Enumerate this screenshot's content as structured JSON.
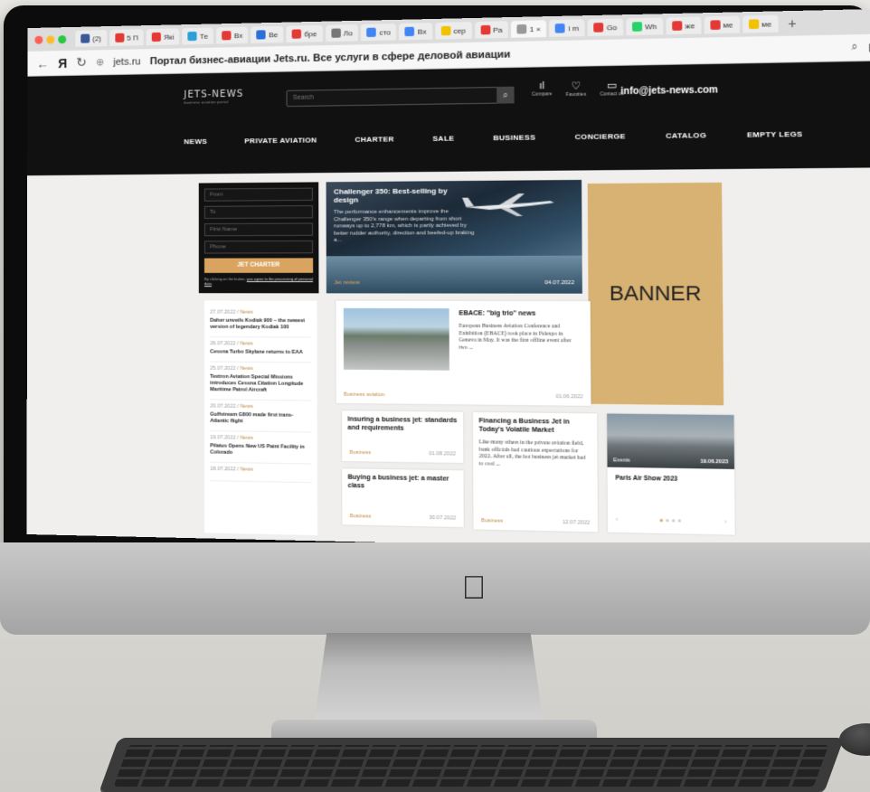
{
  "browser": {
    "tabs": [
      {
        "label": "(2)",
        "color": "#3b5998"
      },
      {
        "label": "5 П",
        "color": "#e53935"
      },
      {
        "label": "Які",
        "color": "#e53935"
      },
      {
        "label": "Те",
        "color": "#2a9fd8"
      },
      {
        "label": "Вх",
        "color": "#e53935"
      },
      {
        "label": "Ве",
        "color": "#2a6fdb"
      },
      {
        "label": "бре",
        "color": "#e53935"
      },
      {
        "label": "Ло",
        "color": "#777777"
      },
      {
        "label": "сто",
        "color": "#4285f4"
      },
      {
        "label": "Вх",
        "color": "#4285f4"
      },
      {
        "label": "сер",
        "color": "#f2c200"
      },
      {
        "label": "Ра",
        "color": "#e53935"
      },
      {
        "label": "1 ×",
        "color": "#999999"
      },
      {
        "label": "i m",
        "color": "#4285f4"
      },
      {
        "label": "Go",
        "color": "#e53935"
      },
      {
        "label": "Wh",
        "color": "#25d366"
      },
      {
        "label": "же",
        "color": "#e53935"
      },
      {
        "label": "ме",
        "color": "#e53935"
      },
      {
        "label": "ме",
        "color": "#f2c200"
      }
    ],
    "url": "jets.ru",
    "page_title": "Портал бизнес-авиации Jets.ru. Все услуги в сфере деловой авиации"
  },
  "site": {
    "logo": "JETS-NEWS",
    "logo_sub": "business aviation portal",
    "search_placeholder": "Search",
    "icons": [
      {
        "label": "Compare",
        "glyph": "ıl"
      },
      {
        "label": "Favorites",
        "glyph": "♡"
      },
      {
        "label": "Contact us",
        "glyph": "▭"
      }
    ],
    "email": "info@jets-news.com",
    "nav": [
      "NEWS",
      "PRIVATE AVIATION",
      "CHARTER",
      "SALE",
      "BUSINESS",
      "CONCIERGE",
      "CATALOG",
      "EMPTY LEGS"
    ]
  },
  "charter_form": {
    "fields": [
      "From",
      "To",
      "First Name",
      "Phone"
    ],
    "button": "JET CHARTER",
    "consent": "By clicking on the button, ",
    "consent_link": "you agree to the processing of personal data"
  },
  "hero": {
    "title": "Challenger 350: Best-selling by design",
    "text": "The performance enhancements improve the Challenger 350's range when departing from short runways up to 2,778 km, which is partly achieved by better rudder authority, direction and beefed-up braking a...",
    "category": "Jet review",
    "date": "04.07.2022"
  },
  "banner": "BANNER",
  "news_list": [
    {
      "date": "27.07.2022",
      "tag": "News",
      "title": "Daher unveils Kodiak 900 – the newest version of legendary Kodiak 100"
    },
    {
      "date": "26.07.2022",
      "tag": "News",
      "title": "Cessna Turbo Skylane returns to EAA"
    },
    {
      "date": "25.07.2022",
      "tag": "News",
      "title": "Textron Aviation Special Missions introduces Cessna Citation Longitude Maritime Patrol Aircraft"
    },
    {
      "date": "20.07.2022",
      "tag": "News",
      "title": "Gulfstream G800 made first trans-Atlantic flight"
    },
    {
      "date": "19.07.2022",
      "tag": "News",
      "title": "Pilatus Opens New US Paint Facility in Colorado"
    },
    {
      "date": "18.07.2022",
      "tag": "News",
      "title": ""
    }
  ],
  "ebace": {
    "title": "EBACE: \"big trio\" news",
    "text": "European Business Aviation Conference and Exhibition (EBACE) took place in Palexpo in Geneva in May. It was the first offline event after two ...",
    "category": "Business aviation",
    "date": "01.06.2022"
  },
  "insuring": {
    "title": "Insuring a business jet: standards and requirements",
    "category": "Business",
    "date": "01.08.2022"
  },
  "buying": {
    "title": "Buying a business jet: a master class",
    "category": "Business",
    "date": "30.07.2022"
  },
  "financing": {
    "title": "Financing a Business Jet in Today's Volatile Market",
    "text": "Like many others in the private aviation field, bank officials had cautious expectations for 2022. After all, the hot business jet market had to cool ...",
    "category": "Business",
    "date": "12.07.2022"
  },
  "paris": {
    "category": "Events",
    "date": "19.06.2023",
    "title": "Paris Air Show 2023"
  }
}
